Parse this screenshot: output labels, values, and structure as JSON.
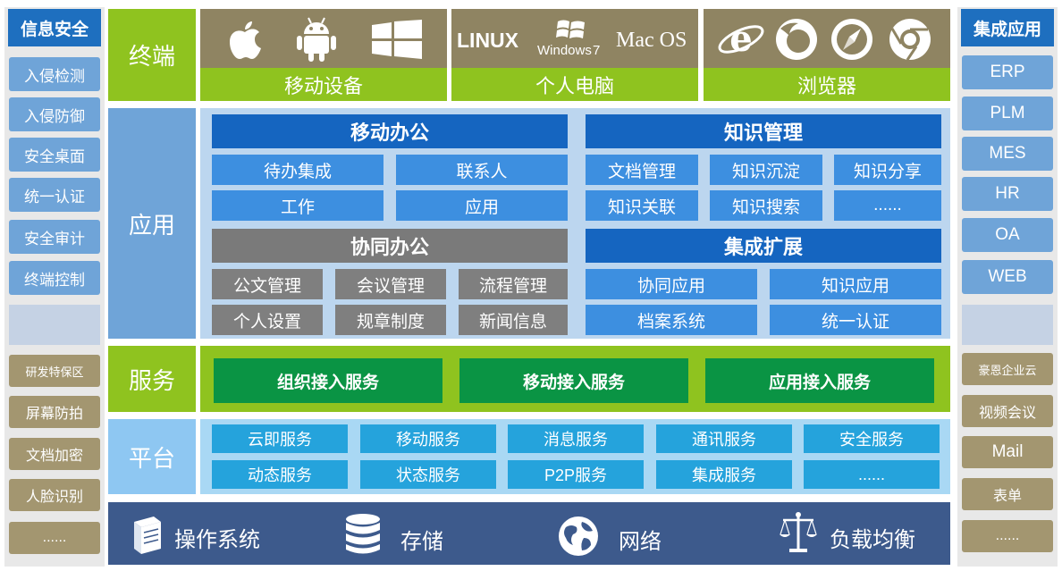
{
  "security": {
    "title": "信息安全",
    "items_top": [
      "入侵检测",
      "入侵防御",
      "安全桌面",
      "统一认证",
      "安全审计",
      "终端控制"
    ],
    "items_bottom": [
      "研发特保区",
      "屏幕防拍",
      "文档加密",
      "人脸识别",
      "......"
    ]
  },
  "integration": {
    "title": "集成应用",
    "items_top": [
      "ERP",
      "PLM",
      "MES",
      "HR",
      "OA",
      "WEB"
    ],
    "items_bottom": [
      "豪恩企业云",
      "视频会议",
      "Mail",
      "表单",
      "......"
    ]
  },
  "terminal": {
    "label": "终端",
    "mobile": "移动设备",
    "pc": "个人电脑",
    "browser": "浏览器",
    "pc_brands": {
      "linux": "LINUX",
      "windows": "Windows",
      "windows_ver": "7",
      "mac": "Mac OS"
    }
  },
  "application": {
    "label": "应用",
    "mobile_office": {
      "title": "移动办公",
      "items": [
        "待办集成",
        "联系人",
        "工作",
        "应用"
      ]
    },
    "knowledge": {
      "title": "知识管理",
      "items": [
        "文档管理",
        "知识沉淀",
        "知识分享",
        "知识关联",
        "知识搜索",
        "......"
      ]
    },
    "collab": {
      "title": "协同办公",
      "items": [
        "公文管理",
        "会议管理",
        "流程管理",
        "个人设置",
        "规章制度",
        "新闻信息"
      ]
    },
    "integration_ext": {
      "title": "集成扩展",
      "items": [
        "协同应用",
        "知识应用",
        "档案系统",
        "统一认证"
      ]
    }
  },
  "service": {
    "label": "服务",
    "items": [
      "组织接入服务",
      "移动接入服务",
      "应用接入服务"
    ]
  },
  "platform": {
    "label": "平台",
    "items": [
      "云即服务",
      "移动服务",
      "消息服务",
      "通讯服务",
      "安全服务",
      "动态服务",
      "状态服务",
      "P2P服务",
      "集成服务",
      "......"
    ]
  },
  "infra": {
    "items": [
      {
        "label": "操作系统",
        "icon": "server-icon"
      },
      {
        "label": "存储",
        "icon": "database-icon"
      },
      {
        "label": "网络",
        "icon": "globe-icon"
      },
      {
        "label": "负载均衡",
        "icon": "scale-icon"
      }
    ]
  },
  "colors": {
    "side_head": "#1e6fbf",
    "side_blue": "#6fa4d8",
    "side_olive": "#a39670",
    "terminal_green": "#8fc31f",
    "terminal_brown": "#8f8462",
    "app_blue": "#1565c0",
    "cell_blue": "#3d8fe0",
    "gray": "#7f7f7f",
    "service_green": "#0a9444",
    "platform_cyan": "#25a3dc",
    "infra_navy": "#3d5a8c"
  }
}
